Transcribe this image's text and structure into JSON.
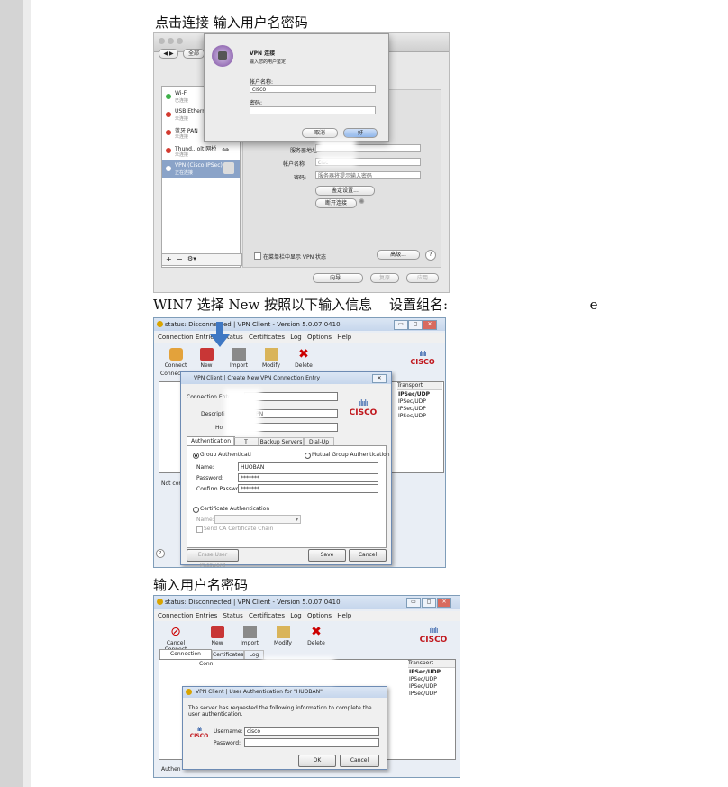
{
  "captions": {
    "step1": "点击连接 输入用户名密码",
    "step2_prefix": "WIN7 选择 New 按照以下输入信息",
    "step2_group": "设置组名:",
    "step2_suffix": "e",
    "step3": "输入用户名密码"
  },
  "mac": {
    "toolbar_label": "全部",
    "services": [
      {
        "name": "Wi-Fi",
        "status": "已连接",
        "color": "#3fb14a"
      },
      {
        "name": "USB Ethern",
        "status": "未连接",
        "color": "#d33a2f"
      },
      {
        "name": "蓝牙 PAN",
        "status": "未连接",
        "color": "#d33a2f"
      },
      {
        "name": "Thund...olt 网桥",
        "status": "未连接",
        "color": "#d33a2f"
      },
      {
        "name": "VPN (Cisco IPSec)",
        "status": "正在连接",
        "color": "#ffffff"
      }
    ],
    "sheet": {
      "title": "VPN 连接",
      "subtitle": "输入您的用户鉴定",
      "account_label": "帐户名称:",
      "account_value": "cisco",
      "password_label": "密码:",
      "cancel": "取消",
      "ok": "好"
    },
    "panel": {
      "server_label": "服务器地址",
      "account_label": "帐户名称",
      "account_value": "cisc",
      "password_label": "密码:",
      "password_placeholder": "服务器将提示输入密码",
      "auth_button": "鉴定设置...",
      "disconnect_button": "断开连接",
      "show_status": "在菜单栏中显示 VPN 状态",
      "advanced_button": "高级...",
      "help": "?"
    },
    "bottom": {
      "add": "+",
      "remove": "−",
      "gear": "⚙▾",
      "assist": "向导...",
      "revert": "复原",
      "apply": "应用"
    }
  },
  "win1": {
    "title": "status: Disconnected | VPN Client - Version 5.0.07.0410",
    "menu": [
      "Connection Entries",
      "Status",
      "Certificates",
      "Log",
      "Options",
      "Help"
    ],
    "toolbar": [
      "Connect",
      "New",
      "Import",
      "Modify",
      "Delete"
    ],
    "tab_partial": "Connect",
    "transport_header": "Transport",
    "transport": [
      "IPSec/UDP",
      "IPSec/UDP",
      "IPSec/UDP",
      "IPSec/UDP"
    ],
    "status_partial": "Not con",
    "cisco_word": "CISCO",
    "dialog": {
      "title": "VPN Client | Create New VPN Connection Entry",
      "close": "✕",
      "connection_entry_label": "Connection Entr",
      "description_label": "Descripti",
      "description_value": "PN",
      "host_label": "Ho",
      "tabs": [
        "Authentication",
        "T",
        "Backup Servers",
        "Dial-Up"
      ],
      "group_auth": "Group Authenticati",
      "mutual_auth": "Mutual Group Authentication",
      "name_label": "Name:",
      "name_value": "HUOBAN",
      "password_label": "Password:",
      "password_value": "*******",
      "confirm_label": "Confirm Password:",
      "confirm_value": "*******",
      "cert_auth": "Certificate Authentication",
      "cert_name_label": "Name:",
      "send_chain": "Send CA Certificate Chain",
      "erase_button": "Erase User Password",
      "save_button": "Save",
      "cancel_button": "Cancel"
    }
  },
  "win2": {
    "title": "status: Disconnected | VPN Client - Version 5.0.07.0410",
    "menu": [
      "Connection Entries",
      "Status",
      "Certificates",
      "Log",
      "Options",
      "Help"
    ],
    "toolbar": [
      "Cancel Connect",
      "New",
      "Import",
      "Modify",
      "Delete"
    ],
    "tabs": [
      "Connection Entries",
      "Certificates",
      "Log"
    ],
    "col_partial": "Conn",
    "transport_header": "Transport",
    "transport": [
      "IPSec/UDP",
      "IPSec/UDP",
      "IPSec/UDP",
      "IPSec/UDP"
    ],
    "status_partial": "Authen",
    "cisco_word": "CISCO",
    "dialog": {
      "title": "VPN Client | User Authentication for \"HUOBAN\"",
      "message": "The server has requested the following information to complete the user authentication.",
      "username_label": "Username:",
      "username_value": "cisco",
      "password_label": "Password:",
      "ok_button": "OK",
      "cancel_button": "Cancel"
    }
  }
}
